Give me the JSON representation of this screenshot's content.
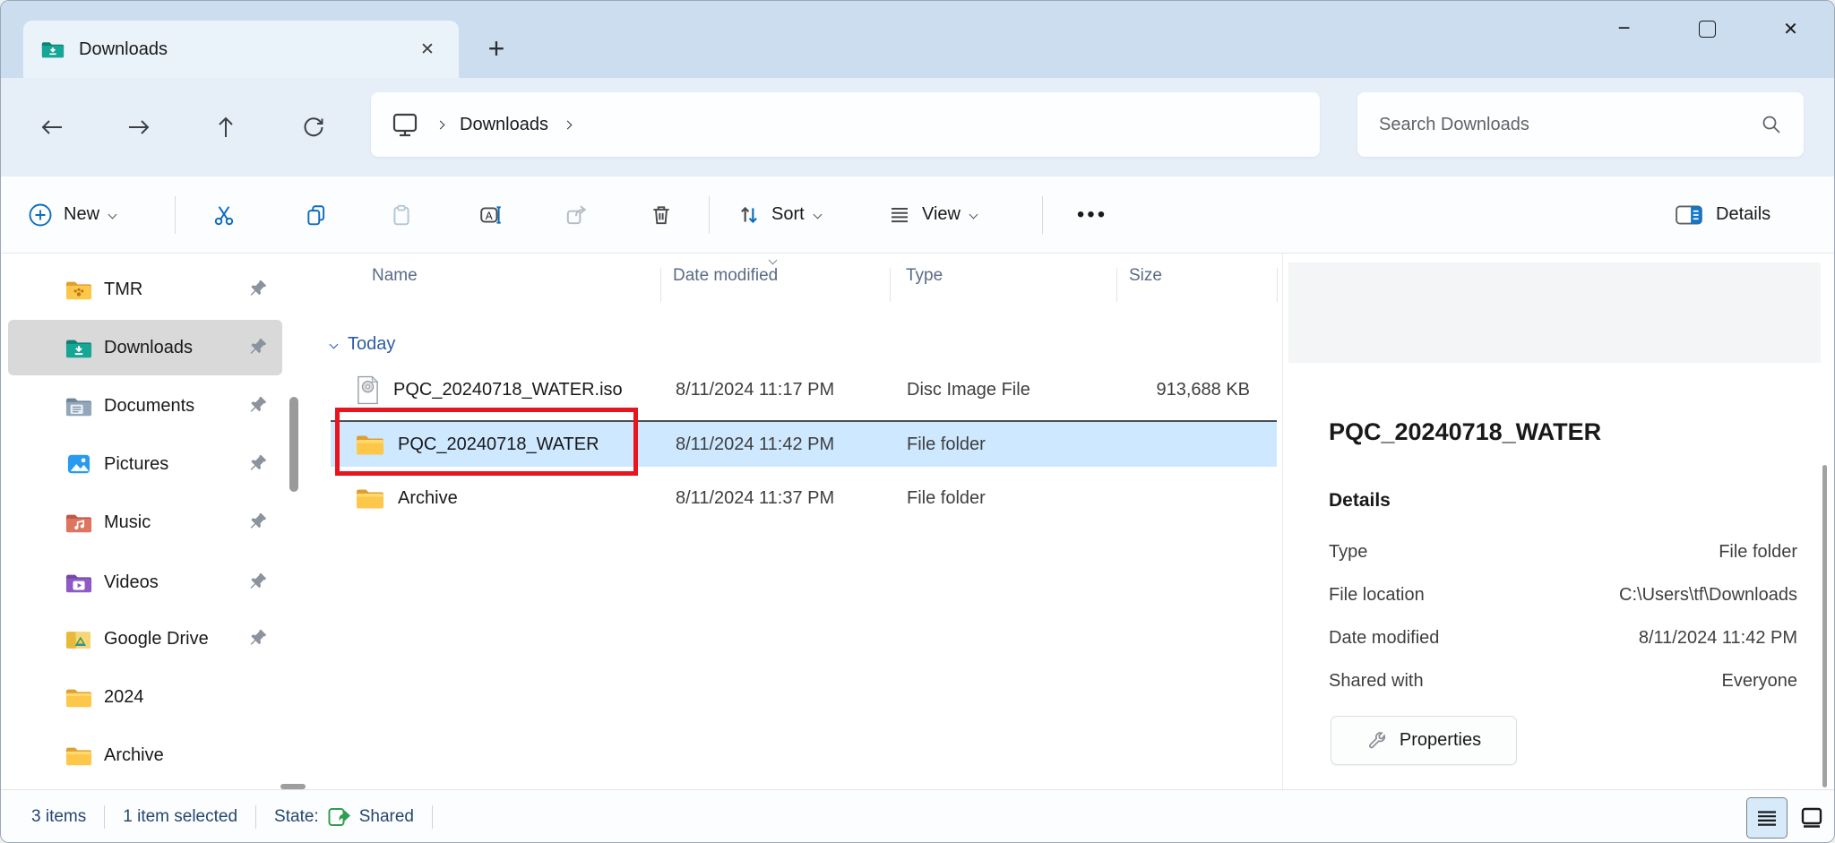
{
  "titlebar": {
    "tab_label": "Downloads",
    "glyphs": {
      "tab_close": "✕",
      "new_tab": "+",
      "minimize": "−",
      "close": "✕"
    }
  },
  "nav": {
    "breadcrumb": {
      "items": [
        "Downloads"
      ]
    },
    "search_placeholder": "Search Downloads"
  },
  "toolbar": {
    "new_label": "New",
    "sort_label": "Sort",
    "view_label": "View",
    "more_glyph": "•••",
    "details_label": "Details"
  },
  "sidebar": {
    "items": [
      {
        "label": "TMR",
        "pinned": true,
        "selected": false
      },
      {
        "label": "Downloads",
        "pinned": true,
        "selected": true
      },
      {
        "label": "Documents",
        "pinned": true,
        "selected": false
      },
      {
        "label": "Pictures",
        "pinned": true,
        "selected": false
      },
      {
        "label": "Music",
        "pinned": true,
        "selected": false
      },
      {
        "label": "Videos",
        "pinned": true,
        "selected": false
      },
      {
        "label": "Google Drive",
        "pinned": true,
        "selected": false
      },
      {
        "label": "2024",
        "pinned": false,
        "selected": false
      },
      {
        "label": "Archive",
        "pinned": false,
        "selected": false
      }
    ]
  },
  "filelist": {
    "columns": [
      "Name",
      "Date modified",
      "Type",
      "Size"
    ],
    "sort_column": "Date modified",
    "group": "Today",
    "rows": [
      {
        "name": "PQC_20240718_WATER.iso",
        "date": "8/11/2024 11:17 PM",
        "type": "Disc Image File",
        "size": "913,688 KB",
        "icon": "disc-image-file-icon",
        "selected": false
      },
      {
        "name": "PQC_20240718_WATER",
        "date": "8/11/2024 11:42 PM",
        "type": "File folder",
        "size": "",
        "icon": "folder-icon",
        "selected": true,
        "annotated": true
      },
      {
        "name": "Archive",
        "date": "8/11/2024 11:37 PM",
        "type": "File folder",
        "size": "",
        "icon": "folder-icon",
        "selected": false
      }
    ]
  },
  "details": {
    "title": "PQC_20240718_WATER",
    "heading": "Details",
    "rows": [
      {
        "label": "Type",
        "value": "File folder"
      },
      {
        "label": "File location",
        "value": "C:\\Users\\tf\\Downloads"
      },
      {
        "label": "Date modified",
        "value": "8/11/2024 11:42 PM"
      },
      {
        "label": "Shared with",
        "value": "Everyone"
      }
    ],
    "properties_label": "Properties"
  },
  "statusbar": {
    "items_count": "3 items",
    "selected_count": "1 item selected",
    "state_label": "State:",
    "state_value": "Shared"
  },
  "colors": {
    "accent_blue": "#0f6cbd",
    "selection_blue": "#cde8ff",
    "annotation_red": "#e8141e",
    "shared_green": "#2f9e4f",
    "titlebar_blue": "#cbddee"
  }
}
